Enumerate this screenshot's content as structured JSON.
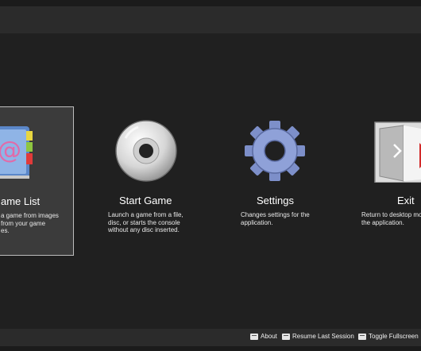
{
  "menu": {
    "game_list": {
      "title": "ame List",
      "desc": "a game from images\n from your game\nes."
    },
    "start_game": {
      "title": "Start Game",
      "desc": "Launch a game from a file,\ndisc, or starts the console\nwithout any disc inserted."
    },
    "settings": {
      "title": "Settings",
      "desc": "Changes settings for the\napplication."
    },
    "exit": {
      "title": "Exit",
      "desc": "Return to desktop mo\nthe application."
    }
  },
  "footer": {
    "about_label": "About",
    "resume_label": "Resume Last Session",
    "fullscreen_label": "Toggle Fullscreen"
  },
  "icons": {
    "game_list": "address-book-icon",
    "start_game": "disc-icon",
    "settings": "gear-icon",
    "exit": "door-exit-icon",
    "key": "keyboard-key-icon"
  },
  "colors": {
    "background": "#202020",
    "bar": "#2b2b2b",
    "selected_tile": "#3b3b3b",
    "selected_border": "#bdbdbd"
  }
}
